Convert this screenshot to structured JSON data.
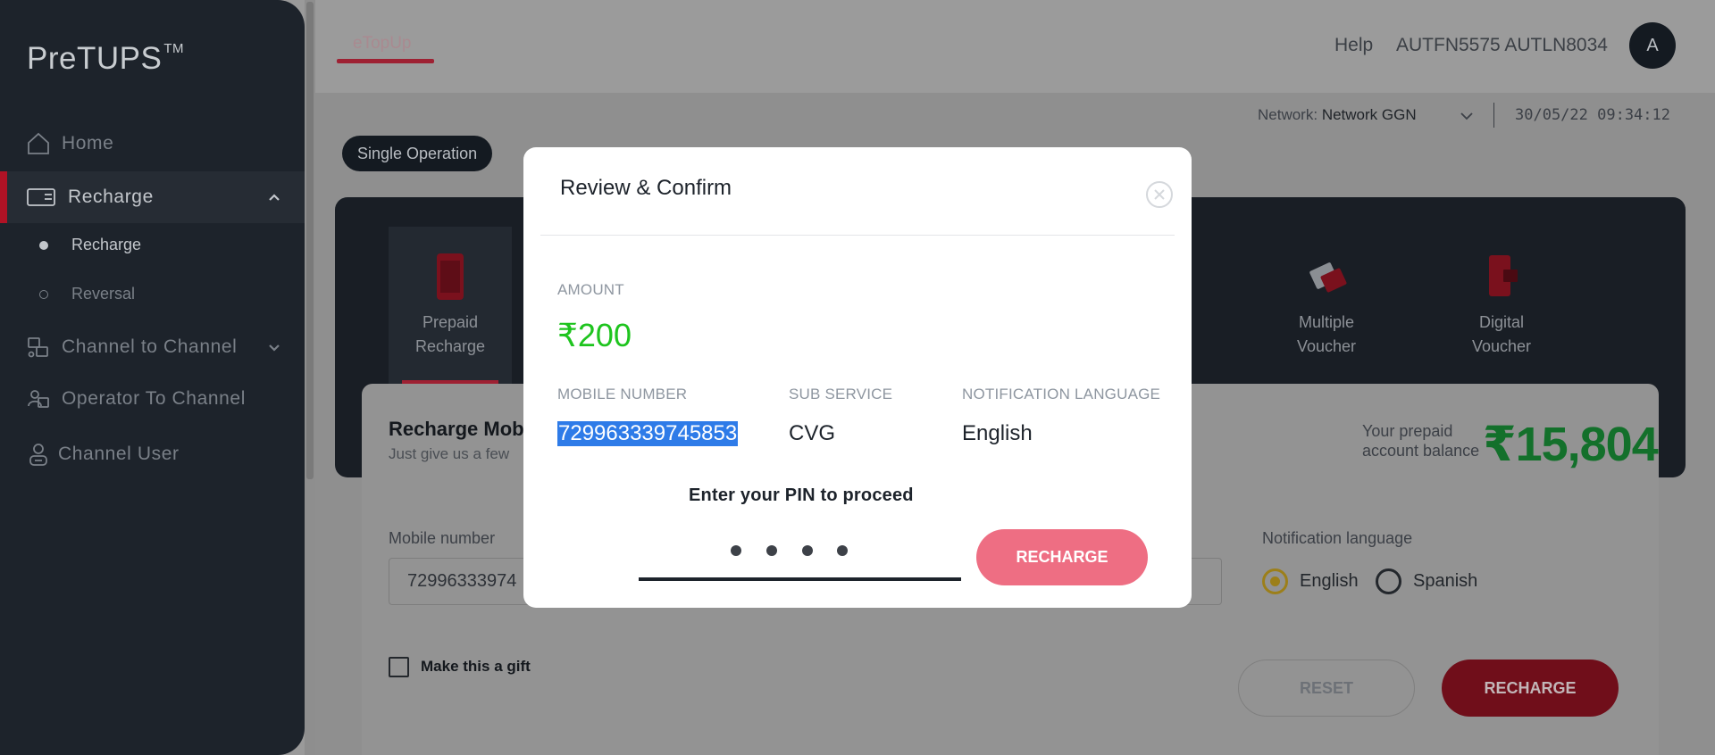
{
  "app": {
    "logo": "PreTUPS",
    "logo_tm": "TM"
  },
  "sidebar": {
    "items": [
      {
        "label": "Home",
        "icon": "home-icon"
      },
      {
        "label": "Recharge",
        "icon": "recharge-icon",
        "active": true
      },
      {
        "label": "Channel to Channel",
        "icon": "channel-transfer-icon"
      },
      {
        "label": "Operator To Channel",
        "icon": "operator-transfer-icon"
      },
      {
        "label": "Channel User",
        "icon": "user-icon"
      }
    ],
    "sub_items": [
      {
        "label": "Recharge",
        "selected": true
      },
      {
        "label": "Reversal",
        "selected": false
      }
    ]
  },
  "header": {
    "tab": "eTopUp",
    "help": "Help",
    "user_name": "AUTFN5575 AUTLN8034",
    "avatar_initial": "A"
  },
  "network": {
    "label": "Network:",
    "value": "Network GGN",
    "datetime": "30/05/22 09:34:12"
  },
  "operation_mode": "Single Operation",
  "services": [
    {
      "line1": "Prepaid",
      "line2": "Recharge",
      "selected": true
    },
    {
      "line1": "Multiple",
      "line2": "Voucher",
      "selected": false
    },
    {
      "line1": "Digital",
      "line2": "Voucher",
      "selected": false
    }
  ],
  "form": {
    "title": "Recharge Mob",
    "subtitle": "Just give us a few",
    "balance_label_1": "Your prepaid",
    "balance_label_2": "account balance",
    "balance_value": "₹15,804",
    "mobile_label": "Mobile number",
    "mobile_value": "72996333974",
    "notif_label": "Notification language",
    "lang_options": [
      "English",
      "Spanish"
    ],
    "lang_selected": "English",
    "gift_label": "Make this a gift",
    "reset_label": "RESET",
    "recharge_label": "RECHARGE"
  },
  "modal": {
    "title": "Review & Confirm",
    "amount_label": "AMOUNT",
    "amount_value": "₹200",
    "mobile_label": "MOBILE NUMBER",
    "mobile_value": "729963339745853",
    "sub_service_label": "SUB SERVICE",
    "sub_service_value": "CVG",
    "notif_lang_label": "NOTIFICATION LANGUAGE",
    "notif_lang_value": "English",
    "pin_prompt": "Enter your PIN to proceed",
    "pin_length": 4,
    "button_label": "RECHARGE"
  },
  "colors": {
    "accent": "#ee6e83",
    "amount_green": "#1ec41e",
    "brand_red": "#b01225",
    "selection_blue": "#2e7be8"
  }
}
